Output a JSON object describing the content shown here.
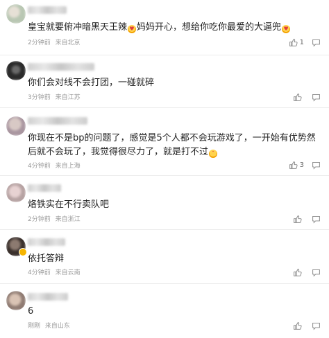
{
  "comments": [
    {
      "text_a": "皇宝就要俯冲暗黑天王辣",
      "text_b": "妈妈开心，想给你吃你最爱的大逼兜",
      "time": "2分钟前",
      "location": "来自北京",
      "likes": "1",
      "avatar_colors": [
        "#b9c7b3",
        "#e6e0d6"
      ]
    },
    {
      "text": "你们会对线不会打团，一碰就碎",
      "time": "3分钟前",
      "location": "来自江苏",
      "likes": "",
      "avatar_colors": [
        "#2b2b2b",
        "#6a6a6a"
      ]
    },
    {
      "text_a": "你现在不是bp的问题了，感觉是5个人都不会玩游戏了，一开始有优势然后就不会玩了，我觉得很尽力了，就是打不过",
      "time": "4分钟前",
      "location": "来自上海",
      "likes": "3",
      "avatar_colors": [
        "#d8c9c5",
        "#a996a0"
      ]
    },
    {
      "text": "烙铁实在不行卖队吧",
      "time": "2分钟前",
      "location": "来自浙江",
      "likes": "",
      "avatar_colors": [
        "#e7d2d2",
        "#b6a2a2"
      ]
    },
    {
      "text": "依托答辩",
      "time": "4分钟前",
      "location": "来自云南",
      "likes": "",
      "avatar_colors": [
        "#3a302c",
        "#8c7a70"
      ]
    },
    {
      "text": "6",
      "time": "刚刚",
      "location": "来自山东",
      "likes": "",
      "avatar_colors": [
        "#d9c3b4",
        "#8f7b72"
      ]
    }
  ]
}
